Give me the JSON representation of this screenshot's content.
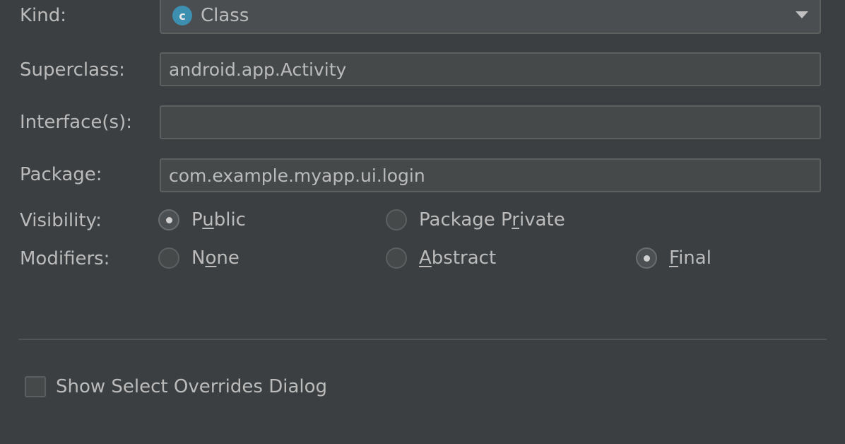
{
  "form": {
    "kind": {
      "label": "Kind:",
      "value": "Class",
      "icon_letter": "c",
      "icon_color": "#3d8fb0"
    },
    "superclass": {
      "label": "Superclass:",
      "value": "android.app.Activity"
    },
    "interfaces": {
      "label": "Interface(s):",
      "value": ""
    },
    "package": {
      "label": "Package:",
      "value": "com.example.myapp.ui.login"
    },
    "visibility": {
      "label": "Visibility:",
      "options": [
        {
          "pre": "P",
          "mnemonic": "u",
          "post": "blic",
          "selected": true
        },
        {
          "pre": "Package P",
          "mnemonic": "r",
          "post": "ivate",
          "selected": false
        }
      ]
    },
    "modifiers": {
      "label": "Modifiers:",
      "options": [
        {
          "pre": "N",
          "mnemonic": "o",
          "post": "ne",
          "selected": false
        },
        {
          "pre": "",
          "mnemonic": "A",
          "post": "bstract",
          "selected": false
        },
        {
          "pre": "",
          "mnemonic": "F",
          "post": "inal",
          "selected": true
        }
      ]
    }
  },
  "overrides_checkbox": {
    "label": "Show Select Overrides Dialog",
    "checked": false
  },
  "colors": {
    "background": "#3c3f41",
    "text": "#bbbbbb",
    "field_border": "#5e6060"
  }
}
